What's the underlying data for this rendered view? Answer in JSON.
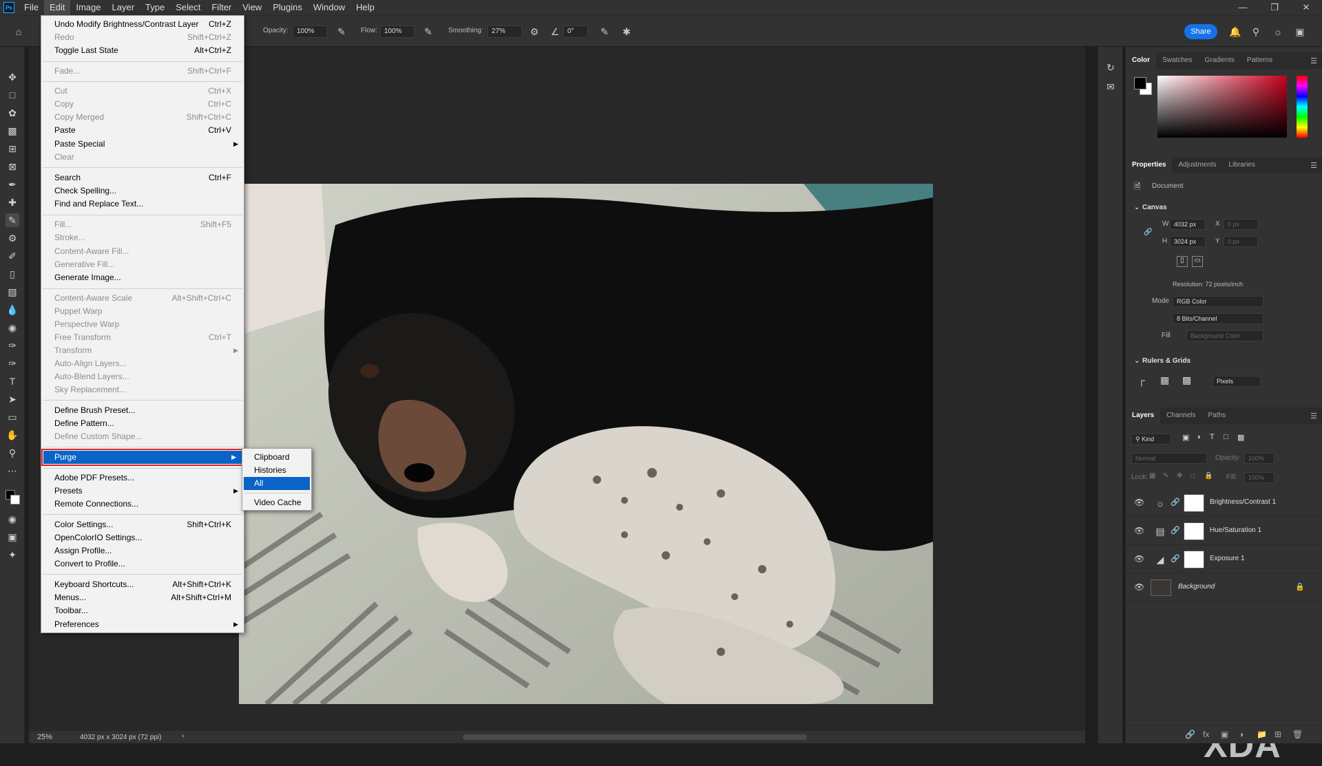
{
  "menubar": {
    "app_icon": "Ps",
    "items": [
      "File",
      "Edit",
      "Image",
      "Layer",
      "Type",
      "Select",
      "Filter",
      "View",
      "Plugins",
      "Window",
      "Help"
    ],
    "active": "Edit"
  },
  "options_bar": {
    "opacity_label": "Opacity:",
    "opacity_value": "100%",
    "flow_label": "Flow:",
    "flow_value": "100%",
    "smoothing_label": "Smoothing:",
    "smoothing_value": "27%",
    "angle_value": "0°",
    "share_label": "Share"
  },
  "edit_menu": {
    "undo": {
      "label": "Undo Modify Brightness/Contrast Layer",
      "shortcut": "Ctrl+Z"
    },
    "redo": {
      "label": "Redo",
      "shortcut": "Shift+Ctrl+Z"
    },
    "toggle": {
      "label": "Toggle Last State",
      "shortcut": "Alt+Ctrl+Z"
    },
    "fade": {
      "label": "Fade...",
      "shortcut": "Shift+Ctrl+F"
    },
    "cut": {
      "label": "Cut",
      "shortcut": "Ctrl+X"
    },
    "copy": {
      "label": "Copy",
      "shortcut": "Ctrl+C"
    },
    "copy_merged": {
      "label": "Copy Merged",
      "shortcut": "Shift+Ctrl+C"
    },
    "paste": {
      "label": "Paste",
      "shortcut": "Ctrl+V"
    },
    "paste_special": {
      "label": "Paste Special"
    },
    "clear": {
      "label": "Clear"
    },
    "search": {
      "label": "Search",
      "shortcut": "Ctrl+F"
    },
    "check_spelling": {
      "label": "Check Spelling..."
    },
    "find_replace": {
      "label": "Find and Replace Text..."
    },
    "fill": {
      "label": "Fill...",
      "shortcut": "Shift+F5"
    },
    "stroke": {
      "label": "Stroke..."
    },
    "content_aware_fill": {
      "label": "Content-Aware Fill..."
    },
    "generative_fill": {
      "label": "Generative Fill..."
    },
    "generate_image": {
      "label": "Generate Image..."
    },
    "content_aware_scale": {
      "label": "Content-Aware Scale",
      "shortcut": "Alt+Shift+Ctrl+C"
    },
    "puppet_warp": {
      "label": "Puppet Warp"
    },
    "perspective_warp": {
      "label": "Perspective Warp"
    },
    "free_transform": {
      "label": "Free Transform",
      "shortcut": "Ctrl+T"
    },
    "transform": {
      "label": "Transform"
    },
    "auto_align": {
      "label": "Auto-Align Layers..."
    },
    "auto_blend": {
      "label": "Auto-Blend Layers..."
    },
    "sky_replacement": {
      "label": "Sky Replacement..."
    },
    "define_brush": {
      "label": "Define Brush Preset..."
    },
    "define_pattern": {
      "label": "Define Pattern..."
    },
    "define_shape": {
      "label": "Define Custom Shape..."
    },
    "purge": {
      "label": "Purge"
    },
    "pdf_presets": {
      "label": "Adobe PDF Presets..."
    },
    "presets": {
      "label": "Presets"
    },
    "remote": {
      "label": "Remote Connections..."
    },
    "color_settings": {
      "label": "Color Settings...",
      "shortcut": "Shift+Ctrl+K"
    },
    "ocio": {
      "label": "OpenColorIO Settings..."
    },
    "assign_profile": {
      "label": "Assign Profile..."
    },
    "convert_profile": {
      "label": "Convert to Profile..."
    },
    "keyboard": {
      "label": "Keyboard Shortcuts...",
      "shortcut": "Alt+Shift+Ctrl+K"
    },
    "menus": {
      "label": "Menus...",
      "shortcut": "Alt+Shift+Ctrl+M"
    },
    "toolbar": {
      "label": "Toolbar..."
    },
    "preferences": {
      "label": "Preferences"
    }
  },
  "purge_submenu": {
    "clipboard": "Clipboard",
    "histories": "Histories",
    "all": "All",
    "video_cache": "Video Cache"
  },
  "status_bar": {
    "zoom": "25%",
    "doc_info": "4032 px x 3024 px (72 ppi)"
  },
  "color_panel": {
    "tabs": [
      "Color",
      "Swatches",
      "Gradients",
      "Patterns"
    ],
    "active": "Color",
    "foreground": "#000000",
    "background": "#ffffff",
    "hue_color": "#c8001e"
  },
  "properties_panel": {
    "tabs": [
      "Properties",
      "Adjustments",
      "Libraries"
    ],
    "active": "Properties",
    "document_label": "Document",
    "canvas_title": "Canvas",
    "w_label": "W",
    "w_value": "4032 px",
    "h_label": "H",
    "h_value": "3024 px",
    "x_label": "X",
    "x_value": "0 px",
    "y_label": "Y",
    "y_value": "0 px",
    "resolution": "Resolution: 72 pixels/inch",
    "mode_label": "Mode",
    "mode_value": "RGB Color",
    "depth_value": "8 Bits/Channel",
    "fill_label": "Fill",
    "fill_value": "Background Color",
    "rulers_title": "Rulers & Grids",
    "units_value": "Pixels"
  },
  "layers_panel": {
    "tabs": [
      "Layers",
      "Channels",
      "Paths"
    ],
    "active": "Layers",
    "kind_label": "Kind",
    "blend_mode": "Normal",
    "opacity_label": "Opacity:",
    "opacity_value": "100%",
    "lock_label": "Lock:",
    "fill_label": "Fill:",
    "fill_value": "100%",
    "layers": [
      {
        "name": "Brightness/Contrast 1",
        "icon": "sun-icon"
      },
      {
        "name": "Hue/Saturation 1",
        "icon": "hue-sat-icon"
      },
      {
        "name": "Exposure 1",
        "icon": "exposure-icon"
      },
      {
        "name": "Background",
        "icon": "photo-thumbnail"
      }
    ]
  },
  "watermark": "XDA"
}
